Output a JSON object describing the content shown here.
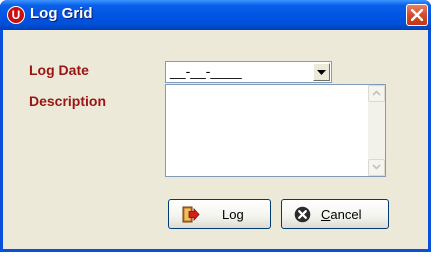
{
  "window": {
    "title": "Log Grid",
    "app_icon_letter": "U"
  },
  "form": {
    "log_date_label": "Log Date",
    "log_date_value": "__-__-____",
    "description_label": "Description",
    "description_value": ""
  },
  "buttons": {
    "log_label": "Log",
    "cancel_label_first": "C",
    "cancel_label_rest": "ancel"
  },
  "colors": {
    "titlebar": "#0054e3",
    "label_text": "#9b1414",
    "dialog_bg": "#ece9d8",
    "close_button": "#d64b2a"
  },
  "icons": {
    "app": "u-logo-icon",
    "close": "close-x-icon",
    "dropdown": "chevron-down-icon",
    "log": "log-entry-icon",
    "cancel": "cancel-x-circle-icon"
  }
}
